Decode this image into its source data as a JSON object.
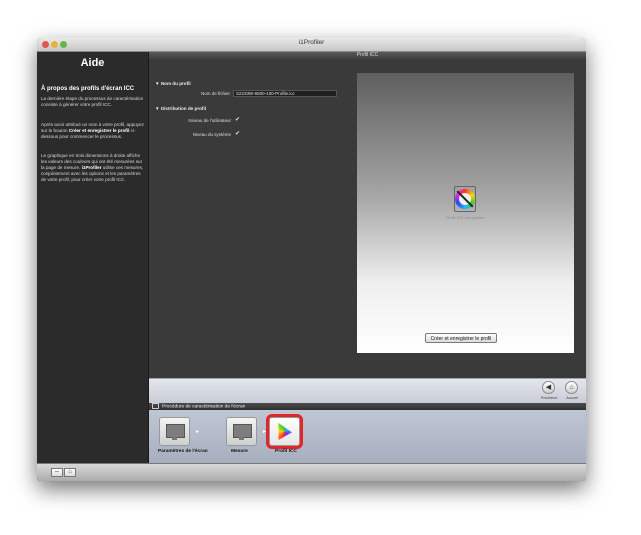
{
  "window": {
    "title": "i1Profiler"
  },
  "sidebar": {
    "header": "Aide",
    "title": "À propos des profils d'écran ICC",
    "p1": "La dernière étape du processus de caractérisation consiste à générer votre profil ICC.",
    "p2_a": "Après avoir attribué un nom à votre profil, appuyez sur le bouton ",
    "p2_b": "Créer et enregistrer le profil",
    "p2_c": " ci-dessous pour commencer le processus.",
    "p3_a": "Le graphique en trois dimensions à droite affiche les valeurs des couleurs qui ont été mesurées sur la page de mesure. ",
    "p3_b": "i1Profiler",
    "p3_c": " utilise ces mesures, conjointement avec les options et les paramètres de votre profil, pour créer votre profil ICC."
  },
  "main": {
    "header": "Profil ICC",
    "section_name": "▼ Nom du profil",
    "filename_label": "Nom de fichier",
    "filename_value": "S2233W-6500-100-Profile.icc",
    "section_distribution": "▼ Distribution de profil",
    "user_level_label": "Niveau de l'utilisateur",
    "system_level_label": "Niveau du système",
    "check_glyph": "✔",
    "preview_caption": "Profil ICC non généré",
    "create_button": "Créer et enregistrer le profil"
  },
  "nav": {
    "previous_label": "Précédent",
    "home_label": "Accueil",
    "previous_icon": "◀",
    "home_icon": "⌂"
  },
  "workflow": {
    "title": "Procédure de caractérisation de l'écran",
    "steps": [
      {
        "label": "Paramètres de l'écran"
      },
      {
        "label": "Mesure"
      },
      {
        "label": "Profil ICC"
      }
    ],
    "arrow": "▸"
  },
  "bottom": {
    "btn1": "⇔",
    "btn2": "⌂"
  },
  "colors": {
    "active_step_outline": "#e0262a",
    "sidebar_bg": "#2b2b2b"
  }
}
